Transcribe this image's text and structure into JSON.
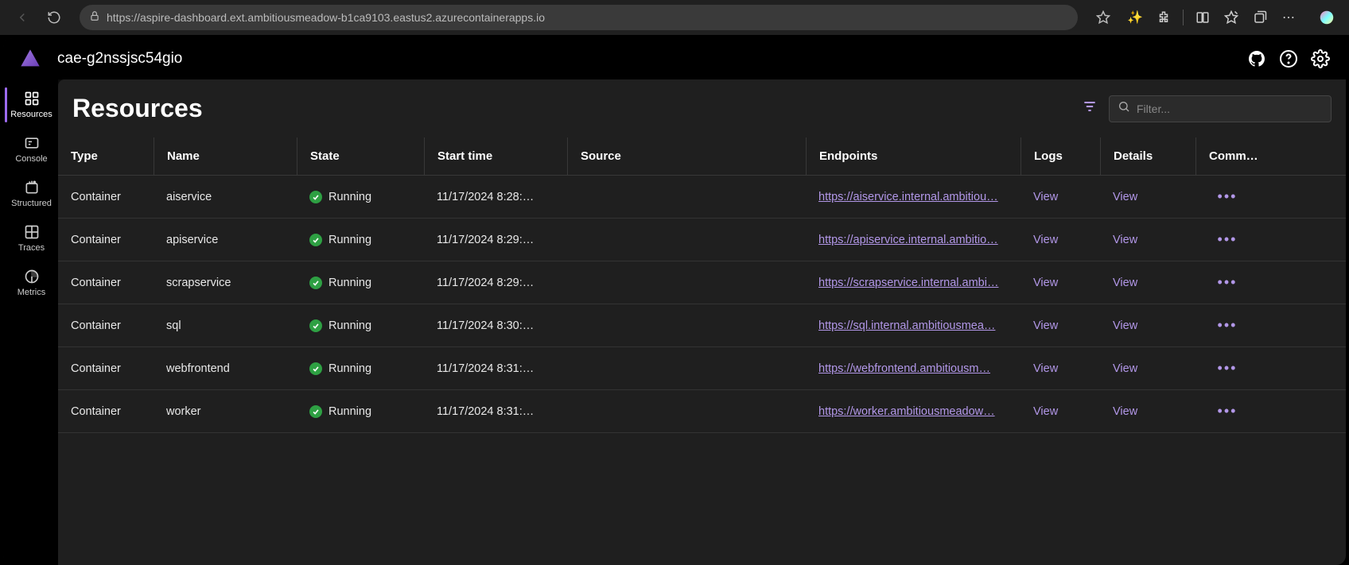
{
  "browser": {
    "url": "https://aspire-dashboard.ext.ambitiousmeadow-b1ca9103.eastus2.azurecontainerapps.io"
  },
  "app": {
    "title": "cae-g2nssjsc54gio"
  },
  "sidebar": {
    "items": [
      {
        "label": "Resources",
        "icon": "grid-icon",
        "active": true
      },
      {
        "label": "Console",
        "icon": "console-icon",
        "active": false
      },
      {
        "label": "Structured",
        "icon": "structured-icon",
        "active": false
      },
      {
        "label": "Traces",
        "icon": "traces-icon",
        "active": false
      },
      {
        "label": "Metrics",
        "icon": "metrics-icon",
        "active": false
      }
    ]
  },
  "page": {
    "title": "Resources",
    "search_placeholder": "Filter..."
  },
  "table": {
    "columns": [
      "Type",
      "Name",
      "State",
      "Start time",
      "Source",
      "Endpoints",
      "Logs",
      "Details",
      "Comm…"
    ],
    "logs_label": "View",
    "details_label": "View",
    "rows": [
      {
        "type": "Container",
        "name": "aiservice",
        "state": "Running",
        "start": "11/17/2024 8:28:…",
        "source": "",
        "endpoint": "https://aiservice.internal.ambitiou…"
      },
      {
        "type": "Container",
        "name": "apiservice",
        "state": "Running",
        "start": "11/17/2024 8:29:…",
        "source": "",
        "endpoint": "https://apiservice.internal.ambitio…"
      },
      {
        "type": "Container",
        "name": "scrapservice",
        "state": "Running",
        "start": "11/17/2024 8:29:…",
        "source": "",
        "endpoint": "https://scrapservice.internal.ambi…"
      },
      {
        "type": "Container",
        "name": "sql",
        "state": "Running",
        "start": "11/17/2024 8:30:…",
        "source": "",
        "endpoint": "https://sql.internal.ambitiousmea…"
      },
      {
        "type": "Container",
        "name": "webfrontend",
        "state": "Running",
        "start": "11/17/2024 8:31:…",
        "source": "",
        "endpoint": "https://webfrontend.ambitiousm…"
      },
      {
        "type": "Container",
        "name": "worker",
        "state": "Running",
        "start": "11/17/2024 8:31:…",
        "source": "",
        "endpoint": "https://worker.ambitiousmeadow…"
      }
    ]
  }
}
